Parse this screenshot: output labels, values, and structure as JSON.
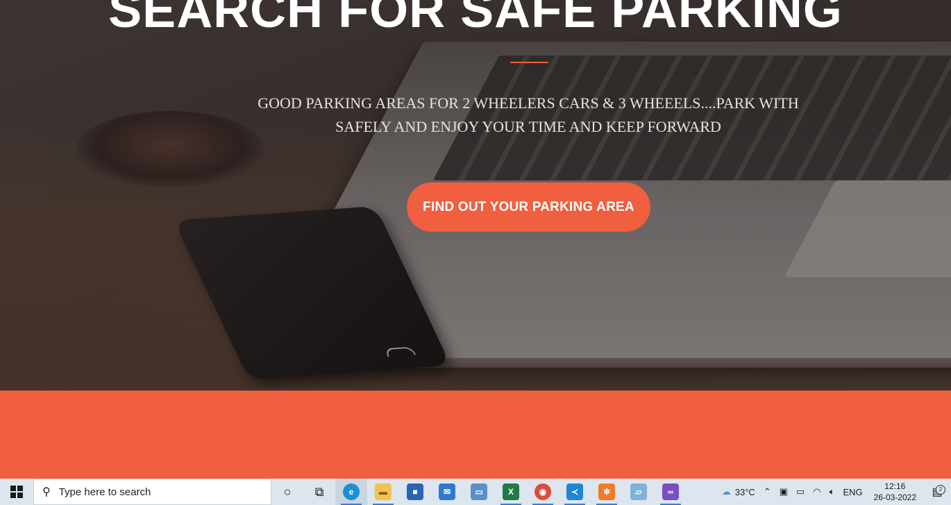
{
  "hero": {
    "title": "SEARCH FOR SAFE PARKING",
    "subtitle": "GOOD PARKING AREAS FOR 2 WHEELERS CARS & 3 WHEEELS....PARK WITH SAFELY AND ENJOY YOUR TIME AND KEEP FORWARD",
    "cta_label": "FIND OUT YOUR PARKING AREA"
  },
  "colors": {
    "accent": "#f05f40",
    "taskbar": "#dde6ee"
  },
  "taskbar": {
    "search_placeholder": "Type here to search",
    "apps": [
      {
        "name": "cortana-icon",
        "symbol": "○"
      },
      {
        "name": "task-view-icon",
        "symbol": "⧉"
      },
      {
        "name": "edge-icon",
        "symbol": "e"
      },
      {
        "name": "file-explorer-icon",
        "symbol": "▬"
      },
      {
        "name": "microsoft-store-icon",
        "symbol": "■"
      },
      {
        "name": "mail-icon",
        "symbol": "✉"
      },
      {
        "name": "remote-desktop-icon",
        "symbol": "▭"
      },
      {
        "name": "excel-icon",
        "symbol": "X"
      },
      {
        "name": "chrome-icon",
        "symbol": "◉"
      },
      {
        "name": "vscode-icon",
        "symbol": "≺"
      },
      {
        "name": "xampp-icon",
        "symbol": "✲"
      },
      {
        "name": "notepad-icon",
        "symbol": "▱"
      },
      {
        "name": "visual-studio-icon",
        "symbol": "∞"
      }
    ],
    "weather": "33°C",
    "language": "ENG",
    "time": "12:16",
    "date": "26-03-2022",
    "notification_count": "2"
  }
}
